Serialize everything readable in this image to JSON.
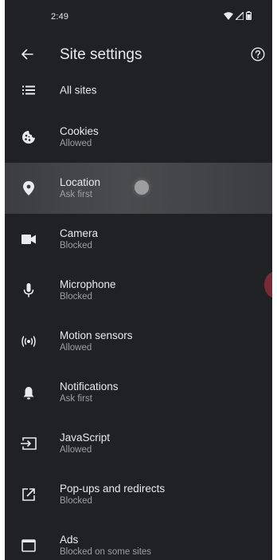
{
  "status_bar": {
    "time": "2:49",
    "icons": [
      "wifi-icon",
      "signal-icon",
      "battery-icon"
    ]
  },
  "toolbar": {
    "title": "Site settings",
    "back_icon": "arrow-left-icon",
    "help_icon": "help-circle-icon"
  },
  "items": [
    {
      "icon": "list-icon",
      "title": "All sites",
      "summary": ""
    },
    {
      "icon": "cookie-icon",
      "title": "Cookies",
      "summary": "Allowed"
    },
    {
      "icon": "location-pin-icon",
      "title": "Location",
      "summary": "Ask first"
    },
    {
      "icon": "videocam-icon",
      "title": "Camera",
      "summary": "Blocked"
    },
    {
      "icon": "microphone-icon",
      "title": "Microphone",
      "summary": "Blocked"
    },
    {
      "icon": "motion-sensors-icon",
      "title": "Motion sensors",
      "summary": "Allowed"
    },
    {
      "icon": "bell-icon",
      "title": "Notifications",
      "summary": "Ask first"
    },
    {
      "icon": "javascript-icon",
      "title": "JavaScript",
      "summary": "Allowed"
    },
    {
      "icon": "open-in-new-icon",
      "title": "Pop-ups and redirects",
      "summary": "Blocked"
    },
    {
      "icon": "ads-icon",
      "title": "Ads",
      "summary": "Blocked on some sites"
    }
  ],
  "colors": {
    "background": "#202124",
    "text_primary": "#e8eaed",
    "text_secondary": "#9aa0a6",
    "highlight_row": "#3c3d40",
    "edge_bubble": "#7a2a35"
  }
}
